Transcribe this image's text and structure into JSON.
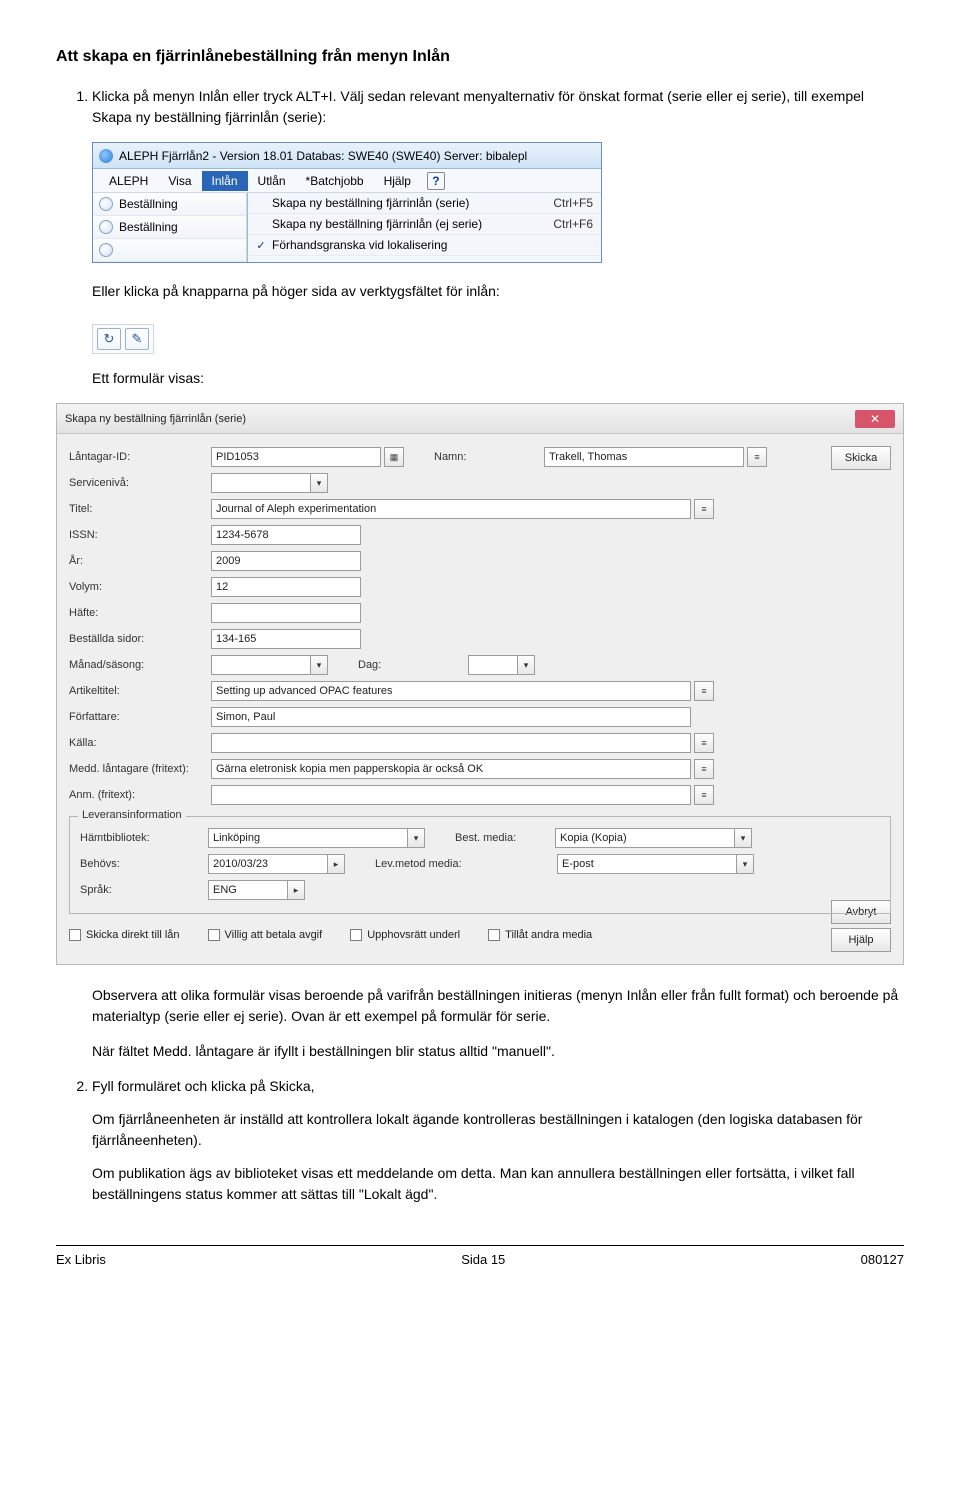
{
  "page": {
    "heading": "Att skapa en fjärrinlånebeställning från menyn Inlån",
    "step1": "Klicka på menyn Inlån eller tryck ALT+I. Välj sedan relevant menyalternativ för önskat format (serie eller ej serie), till exempel Skapa ny beställning fjärrinlån (serie):",
    "mid1": "Eller klicka på knapparna på höger sida av verktygsfältet för inlån:",
    "mid2": "Ett formulär visas:",
    "obs1": "Observera att olika formulär visas beroende på varifrån beställningen initieras (menyn Inlån eller från fullt format) och beroende på materialtyp (serie eller ej serie). Ovan är ett exempel på formulär för serie.",
    "obs2": "När fältet Medd. låntagare är ifyllt i beställningen blir status alltid \"manuell\".",
    "step2": "Fyll formuläret och klicka på Skicka,",
    "step2a": "Om fjärrlåneenheten är inställd att kontrollera lokalt ägande kontrolleras beställningen i katalogen (den logiska databasen för fjärrlåneenheten).",
    "step2b": "Om publikation ägs av biblioteket visas ett meddelande om detta. Man kan annullera beställningen eller fortsätta, i vilket fall beställningens status kommer att sättas till \"Lokalt ägd\"."
  },
  "menuWin": {
    "title": "ALEPH Fjärrlån2 - Version 18.01  Databas: SWE40 (SWE40)  Server: bibalepl",
    "menubar": [
      "ALEPH",
      "Visa",
      "Inlån",
      "Utlån",
      "*Batchjobb",
      "Hjälp"
    ],
    "tabLabel": "Beställning",
    "items": [
      {
        "label": "Skapa ny beställning fjärrinlån (serie)",
        "shortcut": "Ctrl+F5",
        "checked": false
      },
      {
        "label": "Skapa ny beställning fjärrinlån (ej serie)",
        "shortcut": "Ctrl+F6",
        "checked": false
      },
      {
        "label": "Förhandsgranska vid lokalisering",
        "shortcut": "",
        "checked": true
      }
    ]
  },
  "form": {
    "title": "Skapa ny beställning fjärrinlån (serie)",
    "labels": {
      "lid": "Låntagar-ID:",
      "namn": "Namn:",
      "niva": "Servicenivå:",
      "titel": "Titel:",
      "issn": "ISSN:",
      "ar": "År:",
      "volym": "Volym:",
      "hafte": "Häfte:",
      "sidor": "Beställda sidor:",
      "manad": "Månad/säsong:",
      "dag": "Dag:",
      "artikeltitel": "Artikeltitel:",
      "forf": "Författare:",
      "kalla": "Källa:",
      "medd": "Medd. låntagare (fritext):",
      "anm": "Anm. (fritext):",
      "levinfo": "Leveransinformation",
      "hamt": "Hämtbibliotek:",
      "bestmedia": "Best. media:",
      "behovs": "Behövs:",
      "levmetod": "Lev.metod media:",
      "sprak": "Språk:"
    },
    "values": {
      "lid": "PID1053",
      "namn": "Trakell, Thomas",
      "titel": "Journal of Aleph experimentation",
      "issn": "1234-5678",
      "ar": "2009",
      "volym": "12",
      "sidor": "134-165",
      "artikeltitel": "Setting up advanced OPAC features",
      "forf": "Simon, Paul",
      "medd": "Gärna eletronisk kopia men papperskopia är också OK",
      "hamt": "Linköping",
      "bestmedia": "Kopia (Kopia)",
      "behovs": "2010/03/23",
      "levmetod": "E-post",
      "sprak": "ENG"
    },
    "checks": {
      "c1": "Skicka direkt till lån",
      "c2": "Villig att betala avgif",
      "c3": "Upphovsrätt underl",
      "c4": "Tillåt andra media"
    },
    "buttons": {
      "skicka": "Skicka",
      "avbryt": "Avbryt",
      "hjalp": "Hjälp"
    }
  },
  "footer": {
    "left": "Ex Libris",
    "center": "Sida 15",
    "right": "080127"
  }
}
